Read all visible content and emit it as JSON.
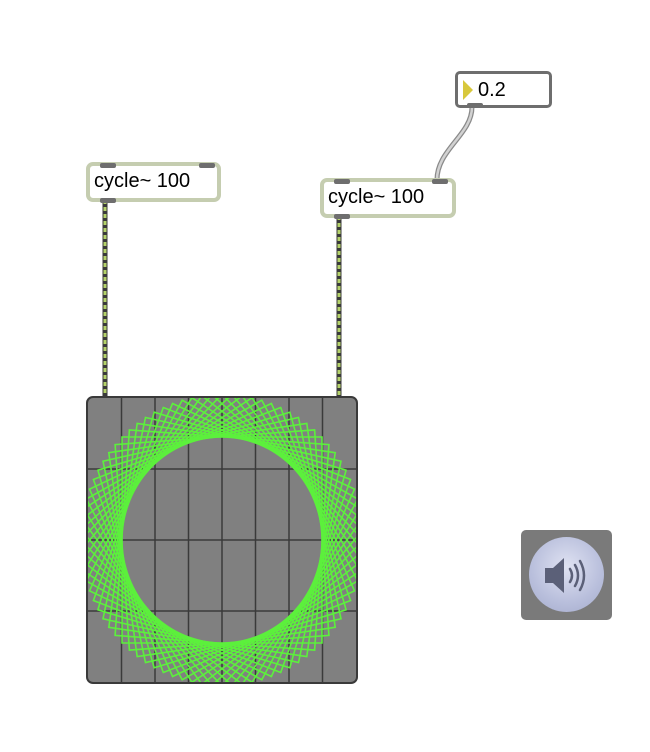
{
  "objects": {
    "cycle_left": {
      "label": "cycle~ 100"
    },
    "cycle_right": {
      "label": "cycle~ 100"
    }
  },
  "number_box": {
    "value": "0.2"
  },
  "scope": {
    "trace_color": "#5cf03c",
    "background": "#808080",
    "grid_color": "#3a3a3a"
  },
  "dac": {
    "icon": "speaker-icon"
  },
  "colors": {
    "object_border": "#c5cdb0",
    "signal_cord": "#b5d36a",
    "control_cord": "#a8a8a8",
    "inlet": "#6e6e6e"
  }
}
